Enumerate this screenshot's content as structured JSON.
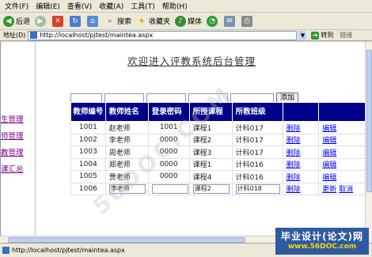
{
  "menu": [
    "文件(F)",
    "编辑(E)",
    "查看(V)",
    "收藏(A)",
    "工具(T)",
    "帮助(H)"
  ],
  "toolbar": {
    "back": "后退",
    "search": "搜索",
    "favorites": "收藏夹",
    "media": "媒体"
  },
  "address": {
    "label": "地址(D)",
    "url": "http://localhost/pjtest/maintea.aspx",
    "go": "转到",
    "links": "链接"
  },
  "sidebar": [
    "生管理",
    "师管理",
    "教管理",
    "课汇总"
  ],
  "page": {
    "title": "欢迎进入评教系统后台管理",
    "add_button": "添加"
  },
  "table": {
    "headers": [
      "教师编号",
      "教师姓名",
      "登录密码",
      "所授课程",
      "所教班级",
      "",
      ""
    ],
    "rows": [
      {
        "id": "1001",
        "name": "赵老师",
        "pwd": "1001",
        "course": "课程1",
        "class": "计科017",
        "del": "删除",
        "edit": "编辑"
      },
      {
        "id": "1002",
        "name": "李老师",
        "pwd": "0000",
        "course": "课程2",
        "class": "计科017",
        "del": "删除",
        "edit": "编辑"
      },
      {
        "id": "1003",
        "name": "周老师",
        "pwd": "0000",
        "course": "课程3",
        "class": "计科017",
        "del": "删除",
        "edit": "编辑"
      },
      {
        "id": "1004",
        "name": "郑老师",
        "pwd": "0000",
        "course": "课程1",
        "class": "计科016",
        "del": "删除",
        "edit": "编辑"
      },
      {
        "id": "1005",
        "name": "贾老师",
        "pwd": "0000",
        "course": "课程4",
        "class": "计科016",
        "del": "删除",
        "edit": "编辑"
      }
    ],
    "edit_row": {
      "id": "1006",
      "name": "李老师",
      "pwd": "",
      "course": "课程2",
      "class": "计科018",
      "del": "删除",
      "update": "更新",
      "cancel": "取消"
    }
  },
  "status": {
    "url": "http://localhost/pjtest/maintea.aspx"
  },
  "watermark": {
    "line1": "毕业设计(论文)网",
    "line2": "www.56DOC.com",
    "diag": "56DOC.COM"
  }
}
